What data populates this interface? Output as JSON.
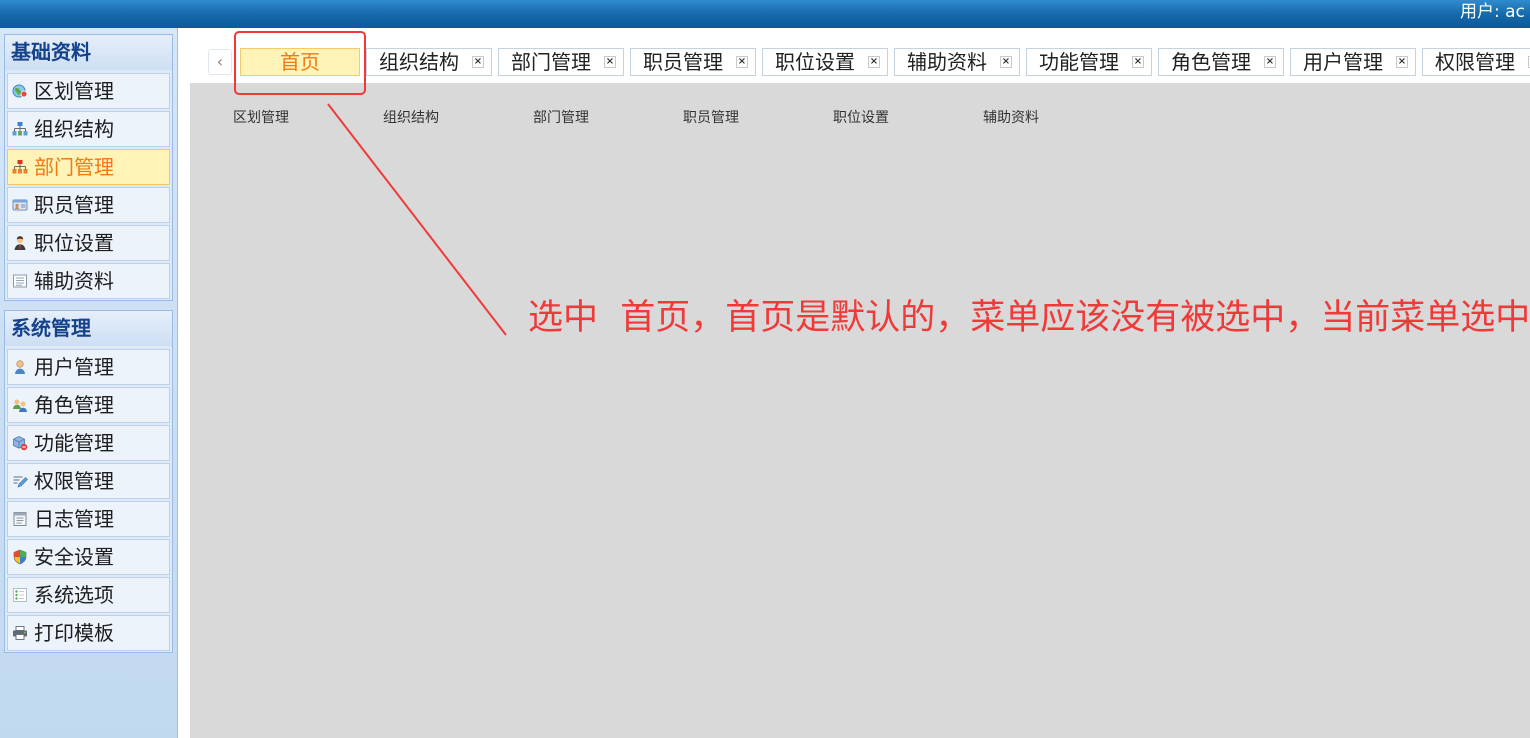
{
  "header": {
    "user_label": "用户: ac"
  },
  "sidebar": {
    "groups": [
      {
        "title": "基础资料",
        "items": [
          {
            "label": "区划管理",
            "icon": "region-icon"
          },
          {
            "label": "组织结构",
            "icon": "org-chart-icon"
          },
          {
            "label": "部门管理",
            "icon": "department-icon",
            "selected": true
          },
          {
            "label": "职员管理",
            "icon": "staff-card-icon"
          },
          {
            "label": "职位设置",
            "icon": "position-icon"
          },
          {
            "label": "辅助资料",
            "icon": "list-document-icon"
          }
        ]
      },
      {
        "title": "系统管理",
        "items": [
          {
            "label": "用户管理",
            "icon": "user-icon"
          },
          {
            "label": "角色管理",
            "icon": "role-group-icon"
          },
          {
            "label": "功能管理",
            "icon": "function-cube-icon"
          },
          {
            "label": "权限管理",
            "icon": "permission-icon"
          },
          {
            "label": "日志管理",
            "icon": "log-icon"
          },
          {
            "label": "安全设置",
            "icon": "security-shield-icon"
          },
          {
            "label": "系统选项",
            "icon": "system-options-icon"
          },
          {
            "label": "打印模板",
            "icon": "printer-icon"
          }
        ]
      }
    ]
  },
  "tabs": {
    "scroll_left_glyph": "‹",
    "close_glyph": "×",
    "items": [
      {
        "label": "首页",
        "active": true,
        "closable": false
      },
      {
        "label": "组织结构",
        "closable": true
      },
      {
        "label": "部门管理",
        "closable": true
      },
      {
        "label": "职员管理",
        "closable": true
      },
      {
        "label": "职位设置",
        "closable": true
      },
      {
        "label": "辅助资料",
        "closable": true
      },
      {
        "label": "功能管理",
        "closable": true
      },
      {
        "label": "角色管理",
        "closable": true
      },
      {
        "label": "用户管理",
        "closable": true
      },
      {
        "label": "权限管理",
        "closable": true
      }
    ]
  },
  "content": {
    "shortcuts": [
      "区划管理",
      "组织结构",
      "部门管理",
      "职员管理",
      "职位设置",
      "辅助资料"
    ]
  },
  "annotation": {
    "text": "选中  首页，首页是默认的，菜单应该没有被选中，当前菜单选中"
  },
  "colors": {
    "header_bg": "#1467a8",
    "selected_bg": "#fff3b8",
    "selected_text": "#ee7a12",
    "annotation": "#f03a3a",
    "content_bg": "#d9d9d9"
  }
}
